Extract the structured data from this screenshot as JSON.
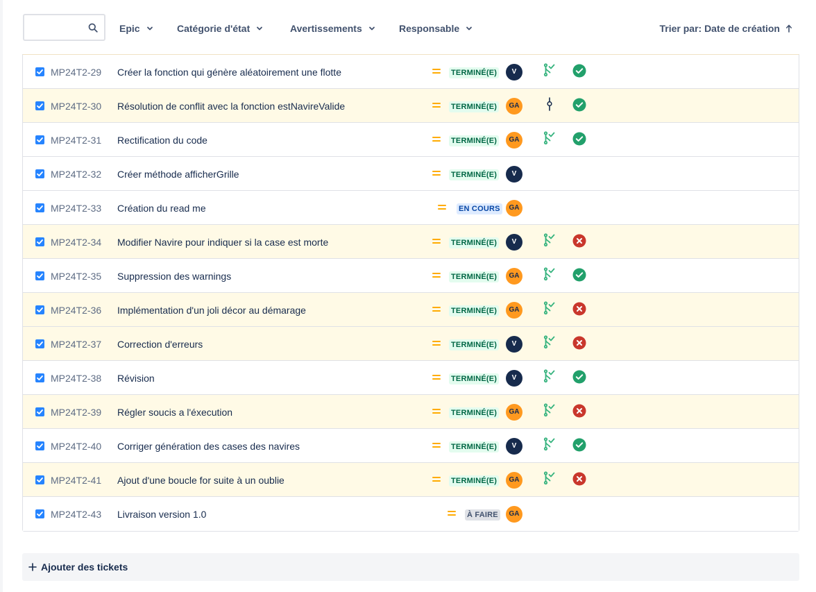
{
  "search": {
    "placeholder": "",
    "value": ""
  },
  "filters": {
    "epic": "Epic",
    "status_category": "Catégorie d'état",
    "warnings": "Avertissements",
    "assignee": "Responsable"
  },
  "sort": {
    "label": "Trier par: Date de création",
    "direction": "arrow-up-icon"
  },
  "colors": {
    "done_bg": "#e3fcef",
    "done_text": "#006644",
    "in_progress_bg": "#deebff",
    "in_progress_text": "#0747a6",
    "todo_bg": "#dfe1e6",
    "todo_text": "#42526e",
    "flag_row": "#fffae6",
    "priority_medium": "#ffab00",
    "branch_green": "#36b37e",
    "build_success": "#22a06b",
    "build_fail": "#c9372c",
    "avatar_v": "#172b4d",
    "avatar_ga": "#ff991f"
  },
  "issues": [
    {
      "key": "MP24T2-29",
      "summary": "Créer la fonction qui génère aléatoirement une flotte",
      "status": "TERMINÉ(E)",
      "status_type": "done",
      "assignee": "V",
      "flagged": false,
      "dev": "branch",
      "build": "success"
    },
    {
      "key": "MP24T2-30",
      "summary": "Résolution de conflit avec la fonction estNavireValide",
      "status": "TERMINÉ(E)",
      "status_type": "done",
      "assignee": "GA",
      "flagged": true,
      "dev": "commit",
      "build": "success"
    },
    {
      "key": "MP24T2-31",
      "summary": "Rectification du code",
      "status": "TERMINÉ(E)",
      "status_type": "done",
      "assignee": "GA",
      "flagged": false,
      "dev": "branch",
      "build": "success"
    },
    {
      "key": "MP24T2-32",
      "summary": "Créer méthode afficherGrille",
      "status": "TERMINÉ(E)",
      "status_type": "done",
      "assignee": "V",
      "flagged": false,
      "dev": "",
      "build": ""
    },
    {
      "key": "MP24T2-33",
      "summary": "Création du read me",
      "status": "EN COURS",
      "status_type": "progress",
      "assignee": "GA",
      "flagged": false,
      "dev": "",
      "build": ""
    },
    {
      "key": "MP24T2-34",
      "summary": "Modifier Navire pour indiquer si la case est morte",
      "status": "TERMINÉ(E)",
      "status_type": "done",
      "assignee": "V",
      "flagged": true,
      "dev": "branch",
      "build": "fail"
    },
    {
      "key": "MP24T2-35",
      "summary": "Suppression des warnings",
      "status": "TERMINÉ(E)",
      "status_type": "done",
      "assignee": "GA",
      "flagged": false,
      "dev": "branch",
      "build": "success"
    },
    {
      "key": "MP24T2-36",
      "summary": "Implémentation d'un joli décor au démarage",
      "status": "TERMINÉ(E)",
      "status_type": "done",
      "assignee": "GA",
      "flagged": true,
      "dev": "branch",
      "build": "fail"
    },
    {
      "key": "MP24T2-37",
      "summary": "Correction d'erreurs",
      "status": "TERMINÉ(E)",
      "status_type": "done",
      "assignee": "V",
      "flagged": true,
      "dev": "branch",
      "build": "fail"
    },
    {
      "key": "MP24T2-38",
      "summary": "Révision",
      "status": "TERMINÉ(E)",
      "status_type": "done",
      "assignee": "V",
      "flagged": false,
      "dev": "branch",
      "build": "success"
    },
    {
      "key": "MP24T2-39",
      "summary": "Régler soucis a l'éxecution",
      "status": "TERMINÉ(E)",
      "status_type": "done",
      "assignee": "GA",
      "flagged": true,
      "dev": "branch",
      "build": "fail"
    },
    {
      "key": "MP24T2-40",
      "summary": "Corriger génération des cases des navires",
      "status": "TERMINÉ(E)",
      "status_type": "done",
      "assignee": "V",
      "flagged": false,
      "dev": "branch",
      "build": "success"
    },
    {
      "key": "MP24T2-41",
      "summary": "Ajout d'une boucle for suite à un oublie",
      "status": "TERMINÉ(E)",
      "status_type": "done",
      "assignee": "GA",
      "flagged": true,
      "dev": "branch",
      "build": "fail"
    },
    {
      "key": "MP24T2-43",
      "summary": "Livraison version 1.0",
      "status": "À FAIRE",
      "status_type": "todo",
      "assignee": "GA",
      "flagged": false,
      "dev": "",
      "build": ""
    }
  ],
  "add_tickets": {
    "label": "Ajouter des tickets"
  }
}
